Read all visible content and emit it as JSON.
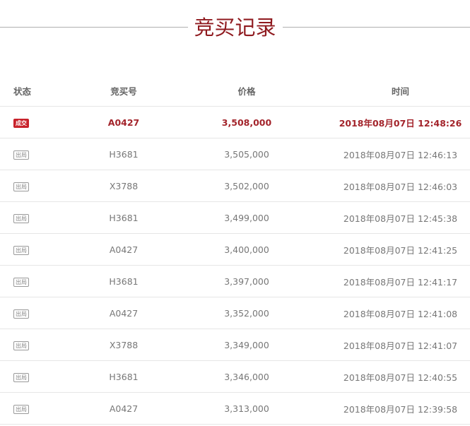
{
  "title": "竞买记录",
  "headers": {
    "status": "状态",
    "bid_no": "竞买号",
    "price": "价格",
    "time": "时间"
  },
  "colors": {
    "accent": "#a3242b",
    "badge_win": "#c8222b"
  },
  "rows": [
    {
      "status": "成交",
      "bid_no": "A0427",
      "price": "3,508,000",
      "time": "2018年08月07日 12:48:26"
    },
    {
      "status": "出局",
      "bid_no": "H3681",
      "price": "3,505,000",
      "time": "2018年08月07日 12:46:13"
    },
    {
      "status": "出局",
      "bid_no": "X3788",
      "price": "3,502,000",
      "time": "2018年08月07日 12:46:03"
    },
    {
      "status": "出局",
      "bid_no": "H3681",
      "price": "3,499,000",
      "time": "2018年08月07日 12:45:38"
    },
    {
      "status": "出局",
      "bid_no": "A0427",
      "price": "3,400,000",
      "time": "2018年08月07日 12:41:25"
    },
    {
      "status": "出局",
      "bid_no": "H3681",
      "price": "3,397,000",
      "time": "2018年08月07日 12:41:17"
    },
    {
      "status": "出局",
      "bid_no": "A0427",
      "price": "3,352,000",
      "time": "2018年08月07日 12:41:08"
    },
    {
      "status": "出局",
      "bid_no": "X3788",
      "price": "3,349,000",
      "time": "2018年08月07日 12:41:07"
    },
    {
      "status": "出局",
      "bid_no": "H3681",
      "price": "3,346,000",
      "time": "2018年08月07日 12:40:55"
    },
    {
      "status": "出局",
      "bid_no": "A0427",
      "price": "3,313,000",
      "time": "2018年08月07日 12:39:58"
    }
  ]
}
